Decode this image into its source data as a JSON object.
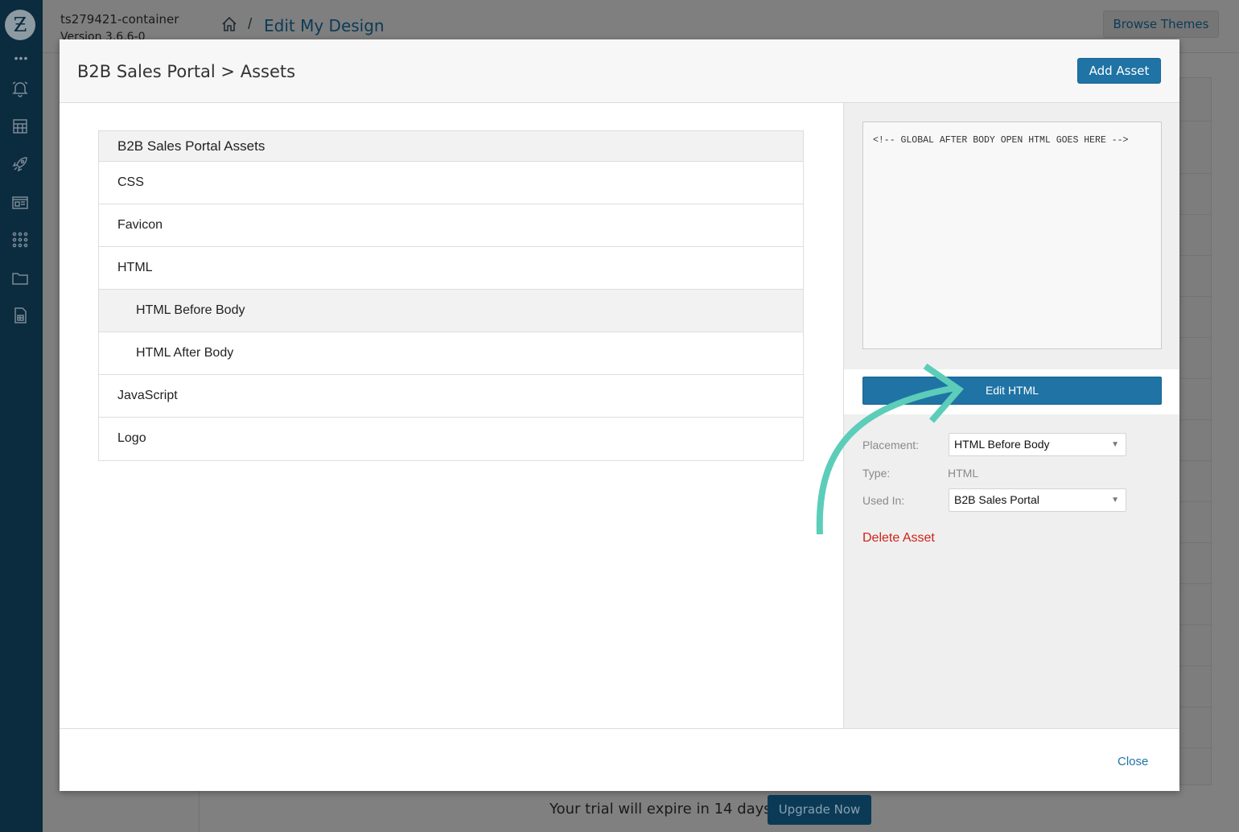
{
  "background_app": {
    "logo_glyph": "Ƶ",
    "more_glyph": "•••",
    "container_name": "ts279421-container",
    "container_version": "Version 3.6.6-0",
    "breadcrumb_separator": "/",
    "breadcrumb_title": "Edit My Design",
    "browse_themes_label": "Browse Themes",
    "sidebar_icons": [
      "bell-icon",
      "storefront-icon",
      "rocket-icon",
      "browser-window-icon",
      "apps-grid-icon",
      "folder-icon",
      "spreadsheet-icon"
    ],
    "trial_text": "Your trial will expire in 14 days",
    "upgrade_label": "Upgrade Now"
  },
  "modal": {
    "title": "B2B Sales Portal > Assets",
    "add_asset_label": "Add Asset",
    "asset_table": {
      "header": "B2B Sales Portal Assets",
      "rows": [
        {
          "label": "CSS",
          "level": 0,
          "active": false
        },
        {
          "label": "Favicon",
          "level": 0,
          "active": false
        },
        {
          "label": "HTML",
          "level": 0,
          "active": false
        },
        {
          "label": "HTML Before Body",
          "level": 1,
          "active": true
        },
        {
          "label": "HTML After Body",
          "level": 1,
          "active": false
        },
        {
          "label": "JavaScript",
          "level": 0,
          "active": false
        },
        {
          "label": "Logo",
          "level": 0,
          "active": false
        }
      ]
    },
    "details": {
      "code_preview": "<!-- GLOBAL AFTER BODY OPEN HTML GOES HERE -->",
      "edit_html_label": "Edit HTML",
      "placement_label": "Placement:",
      "placement_value": "HTML Before Body",
      "type_label": "Type:",
      "type_value": "HTML",
      "used_in_label": "Used In:",
      "used_in_value": "B2B Sales Portal",
      "delete_label": "Delete Asset"
    },
    "close_label": "Close"
  },
  "colors": {
    "primary_button": "#1f73a5",
    "delete_red": "#d0221a",
    "annotation_arrow": "#5ccdb9",
    "sidebar_bg": "#0b2b3f"
  }
}
